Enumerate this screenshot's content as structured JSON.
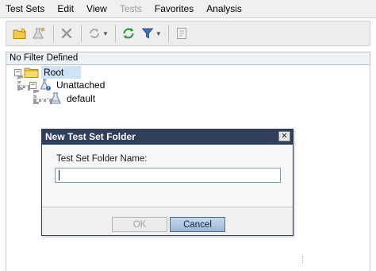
{
  "menu": {
    "items": [
      {
        "label": "Test Sets",
        "enabled": true
      },
      {
        "label": "Edit",
        "enabled": true
      },
      {
        "label": "View",
        "enabled": true
      },
      {
        "label": "Tests",
        "enabled": false
      },
      {
        "label": "Favorites",
        "enabled": true
      },
      {
        "label": "Analysis",
        "enabled": true
      }
    ]
  },
  "toolbar": {
    "buttons": [
      {
        "icon": "new-folder-icon"
      },
      {
        "icon": "new-test-set-icon"
      },
      {
        "icon": "delete-icon"
      },
      {
        "icon": "refresh-dropdown-icon"
      },
      {
        "icon": "refresh-icon"
      },
      {
        "icon": "filter-icon"
      },
      {
        "icon": "details-icon"
      }
    ]
  },
  "filter": {
    "text": "No Filter Defined"
  },
  "tree": {
    "root": {
      "label": "Root",
      "expander": "−"
    },
    "unattached": {
      "label": "Unattached",
      "expander": "−"
    },
    "default": {
      "label": "default"
    }
  },
  "dialog": {
    "title": "New Test Set Folder",
    "close_symbol": "✕",
    "field_label": "Test Set Folder Name:",
    "field_value": "",
    "ok_label": "OK",
    "cancel_label": "Cancel"
  },
  "colors": {
    "dialog_title_bg": "#2f3f5c",
    "selection_bg": "#cfe2f6",
    "folder_yellow": "#f2c94c",
    "refresh_green": "#2e9a3c",
    "filter_blue": "#3d6fb5"
  }
}
